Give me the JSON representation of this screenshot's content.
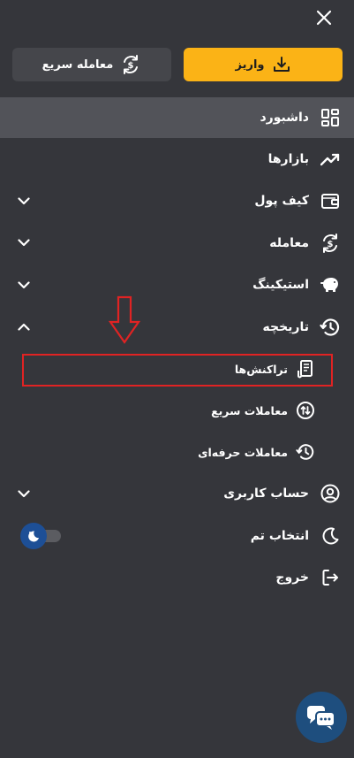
{
  "header": {
    "close_icon": "close-icon"
  },
  "actions": {
    "quick_trade_label": "معامله سریع",
    "deposit_label": "واریز",
    "deposit_color": "#fbb316"
  },
  "menu": {
    "dashboard": "داشبورد",
    "markets": "بازارها",
    "wallet": "کیف پول",
    "trade": "معامله",
    "staking": "استیکینگ",
    "history": "تاریخچه",
    "history_sub": {
      "transactions": "تراکنش‌ها",
      "quick_trades": "معاملات سریع",
      "pro_trades": "معاملات حرفه‌ای"
    },
    "account": "حساب کاربری",
    "theme": "انتخاب تم",
    "logout": "خروج"
  },
  "annotation": {
    "color": "#e02323"
  },
  "colors": {
    "background": "#35363b",
    "active_row": "#525359",
    "chat": "#1e4e7e"
  }
}
